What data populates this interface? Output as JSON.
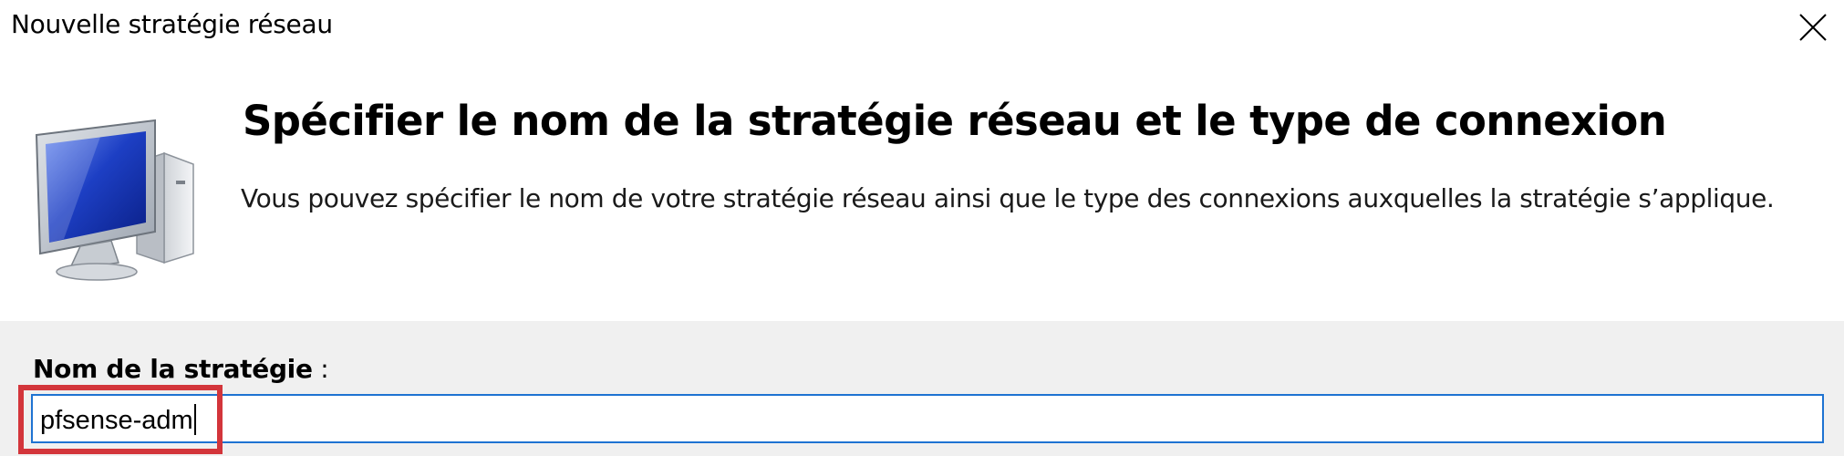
{
  "window": {
    "title": "Nouvelle stratégie réseau",
    "close_icon": "close-icon"
  },
  "header": {
    "icon": "network-computer-icon",
    "heading": "Spécifier le nom de la stratégie réseau et le type de connexion",
    "description": "Vous pouvez spécifier le nom de votre stratégie réseau ainsi que le type des connexions auxquelles la stratégie s’applique."
  },
  "form": {
    "policy_name_label": "Nom de la stratégie",
    "policy_name_label_suffix": " :",
    "policy_name_value": "pfsense-adm"
  },
  "colors": {
    "form_background": "#f0f0f0",
    "input_border": "#1e73d2",
    "highlight_border": "#d3353b"
  }
}
